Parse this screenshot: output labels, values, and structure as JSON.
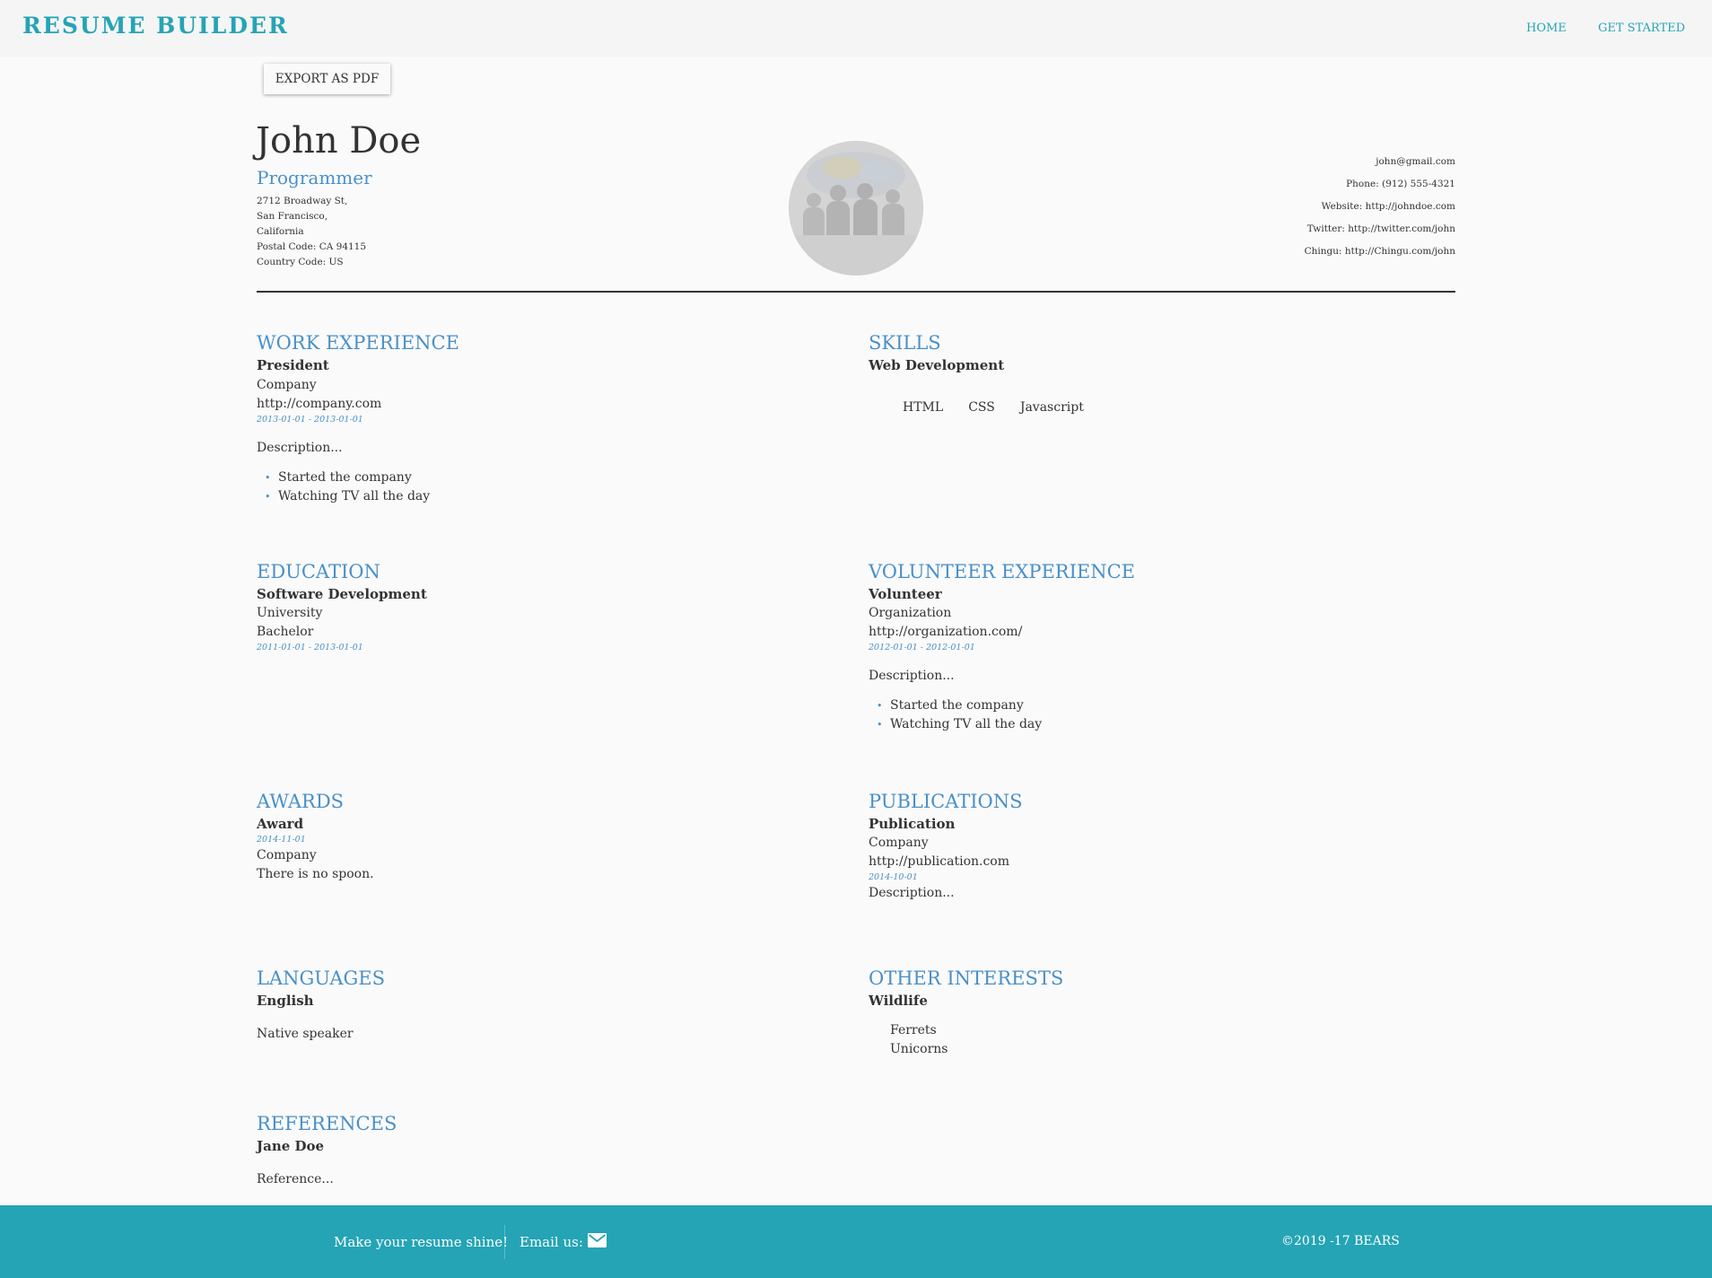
{
  "header": {
    "logo": "RESUME BUILDER",
    "nav": [
      {
        "label": "HOME"
      },
      {
        "label": "GET STARTED"
      }
    ]
  },
  "toolbar": {
    "export_label": "EXPORT AS PDF"
  },
  "profile": {
    "name": "John Doe",
    "title": "Programmer",
    "address": [
      "2712 Broadway St,",
      "San Francisco,",
      "California",
      "Postal Code: CA 94115",
      "Country Code: US"
    ],
    "contacts": [
      "john@gmail.com",
      "Phone: (912) 555-4321",
      "Website: http://johndoe.com",
      "Twitter: http://twitter.com/john",
      "Chingu: http://Chingu.com/john"
    ]
  },
  "work": {
    "title": "WORK EXPERIENCE",
    "position": "President",
    "company": "Company",
    "url": "http://company.com",
    "dates": "2013-01-01 - 2013-01-01",
    "description": "Description...",
    "highlights": [
      "Started the company",
      "Watching TV all the day"
    ]
  },
  "skills": {
    "title": "SKILLS",
    "name": "Web Development",
    "keywords": [
      "HTML",
      "CSS",
      "Javascript"
    ]
  },
  "education": {
    "title": "EDUCATION",
    "area": "Software Development",
    "institution": "University",
    "degree": "Bachelor",
    "dates": "2011-01-01 - 2013-01-01"
  },
  "volunteer": {
    "title": "VOLUNTEER EXPERIENCE",
    "position": "Volunteer",
    "organization": "Organization",
    "url": "http://organization.com/",
    "dates": "2012-01-01 - 2012-01-01",
    "description": "Description...",
    "highlights": [
      "Started the company",
      "Watching TV all the day"
    ]
  },
  "awards": {
    "title": "AWARDS",
    "name": "Award",
    "date": "2014-11-01",
    "awarder": "Company",
    "summary": "There is no spoon."
  },
  "publications": {
    "title": "PUBLICATIONS",
    "name": "Publication",
    "publisher": "Company",
    "url": "http://publication.com",
    "date": "2014-10-01",
    "description": "Description..."
  },
  "languages": {
    "title": "LANGUAGES",
    "language": "English",
    "fluency": "Native speaker"
  },
  "interests": {
    "title": "OTHER INTERESTS",
    "name": "Wildlife",
    "keywords": [
      "Ferrets",
      "Unicorns"
    ]
  },
  "references": {
    "title": "REFERENCES",
    "name": "Jane Doe",
    "reference": "Reference..."
  },
  "footer": {
    "tagline": "Make your resume shine!",
    "email_label": "Email us:",
    "copyright": "©2019 -17 BEARS"
  },
  "colors": {
    "accent": "#25a4b5",
    "heading": "#4a90c8",
    "text": "#333333",
    "background": "#fafafa"
  },
  "icons": {
    "footer_email": "envelope-icon"
  }
}
